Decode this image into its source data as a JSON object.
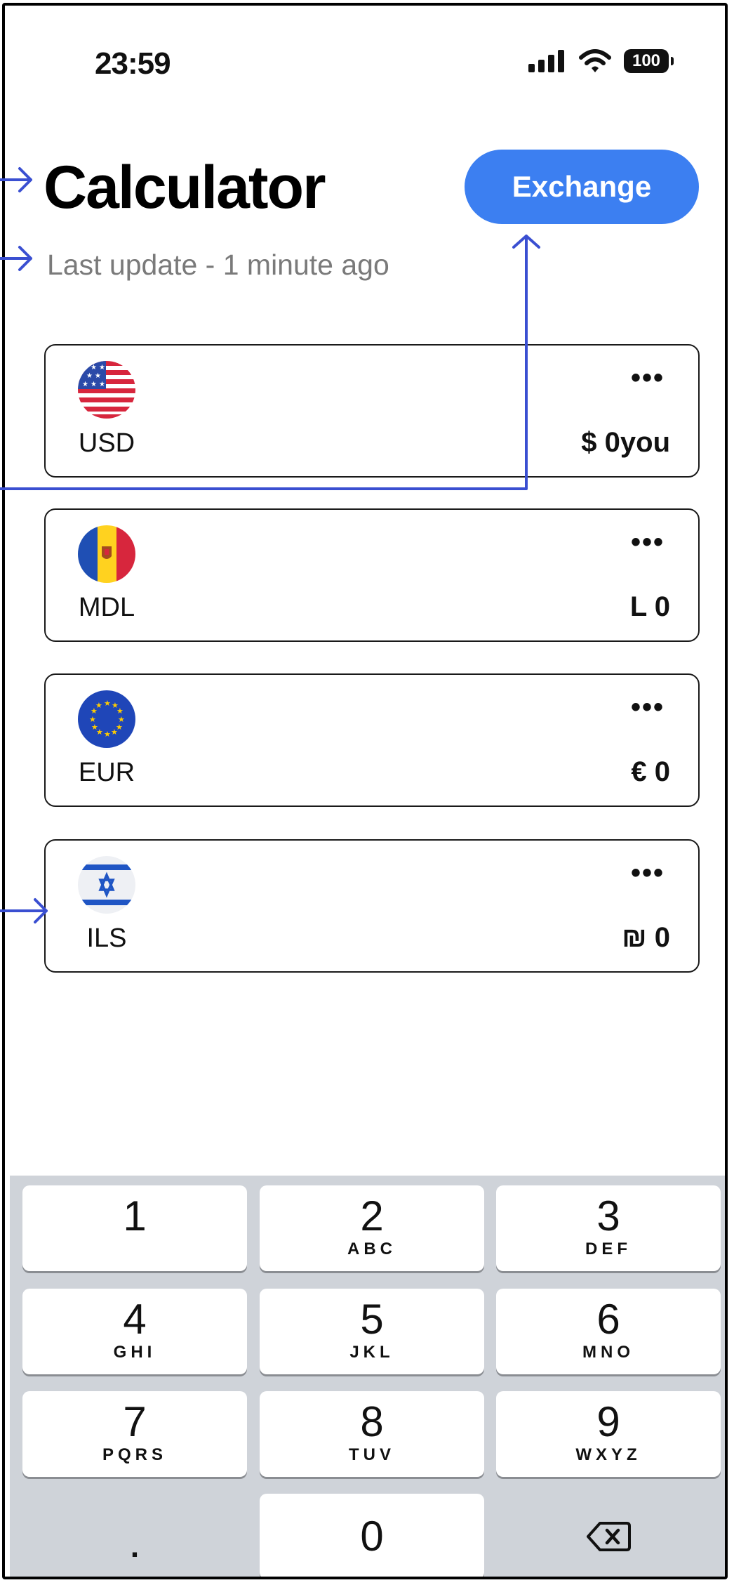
{
  "status_bar": {
    "time": "23:59",
    "battery": "100"
  },
  "header": {
    "title": "Calculator",
    "subtitle": "Last update - 1 minute ago",
    "exchange_label": "Exchange"
  },
  "currencies": [
    {
      "code": "USD",
      "amount": "$ 0you",
      "more": "•••"
    },
    {
      "code": "MDL",
      "amount": "L 0",
      "more": "•••"
    },
    {
      "code": "EUR",
      "amount": "€ 0",
      "more": "•••"
    },
    {
      "code": "ILS",
      "amount": "₪ 0",
      "more": "•••"
    }
  ],
  "keypad": {
    "keys": [
      {
        "num": "1",
        "letters": ""
      },
      {
        "num": "2",
        "letters": "ABC"
      },
      {
        "num": "3",
        "letters": "DEF"
      },
      {
        "num": "4",
        "letters": "GHI"
      },
      {
        "num": "5",
        "letters": "JKL"
      },
      {
        "num": "6",
        "letters": "MNO"
      },
      {
        "num": "7",
        "letters": "PQRS"
      },
      {
        "num": "8",
        "letters": "TUV"
      },
      {
        "num": "9",
        "letters": "WXYZ"
      },
      {
        "num": "0",
        "letters": ""
      }
    ],
    "decimal": ".",
    "delete_icon": "backspace-icon"
  },
  "colors": {
    "accent": "#3c7ff1",
    "annotation": "#3a4fd1",
    "keypad_bg": "#cfd3d9"
  }
}
